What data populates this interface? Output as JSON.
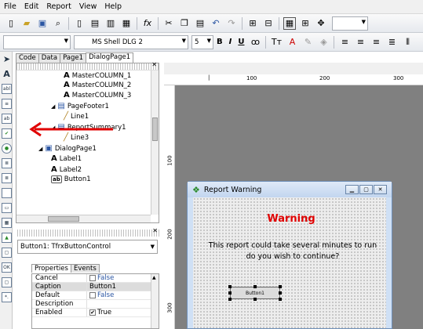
{
  "menu": [
    "File",
    "Edit",
    "Report",
    "View",
    "Help"
  ],
  "toolbar": {
    "font_name": "MS Shell DLG 2",
    "font_size": "5",
    "style_combo": "",
    "zoom_combo": "",
    "bold": "B",
    "italic": "I",
    "underline": "U"
  },
  "designer_tabs": [
    "Code",
    "Data",
    "Page1",
    "DialogPage1"
  ],
  "tree": [
    {
      "label": "MasterCOLUMN_1",
      "icon": "A"
    },
    {
      "label": "MasterCOLUMN_2",
      "icon": "A"
    },
    {
      "label": "MasterCOLUMN_3",
      "icon": "A"
    },
    {
      "label": "PageFooter1",
      "icon": "band"
    },
    {
      "label": "Line1",
      "icon": "line"
    },
    {
      "label": "ReportSummary1",
      "icon": "band"
    },
    {
      "label": "Line3",
      "icon": "line"
    },
    {
      "label": "DialogPage1",
      "icon": "page"
    },
    {
      "label": "Label1",
      "icon": "A"
    },
    {
      "label": "Label2",
      "icon": "A"
    },
    {
      "label": "Button1",
      "icon": "ab"
    }
  ],
  "object_selector": "Button1: TfrxButtonControl",
  "property_tabs": [
    "Properties",
    "Events"
  ],
  "properties": [
    {
      "name": "Cancel",
      "value": "False",
      "checkbox": true,
      "checked": false
    },
    {
      "name": "Caption",
      "value": "Button1",
      "checkbox": false
    },
    {
      "name": "Default",
      "value": "False",
      "checkbox": true,
      "checked": false
    },
    {
      "name": "Description",
      "value": "",
      "checkbox": false
    },
    {
      "name": "Enabled",
      "value": "True",
      "checkbox": true,
      "checked": true
    }
  ],
  "ruler": {
    "horizontal": [
      "100",
      "200",
      "300"
    ],
    "vertical": [
      "100",
      "200",
      "300"
    ]
  },
  "dialog": {
    "title": "Report Warning",
    "warning_label": "Warning",
    "message_line1": "This report could take several minutes to run",
    "message_line2": "do you wish to continue?",
    "button_caption": "Button1"
  },
  "colors": {
    "warning_text": "#e00000",
    "annotation_arrow": "#e00000"
  }
}
